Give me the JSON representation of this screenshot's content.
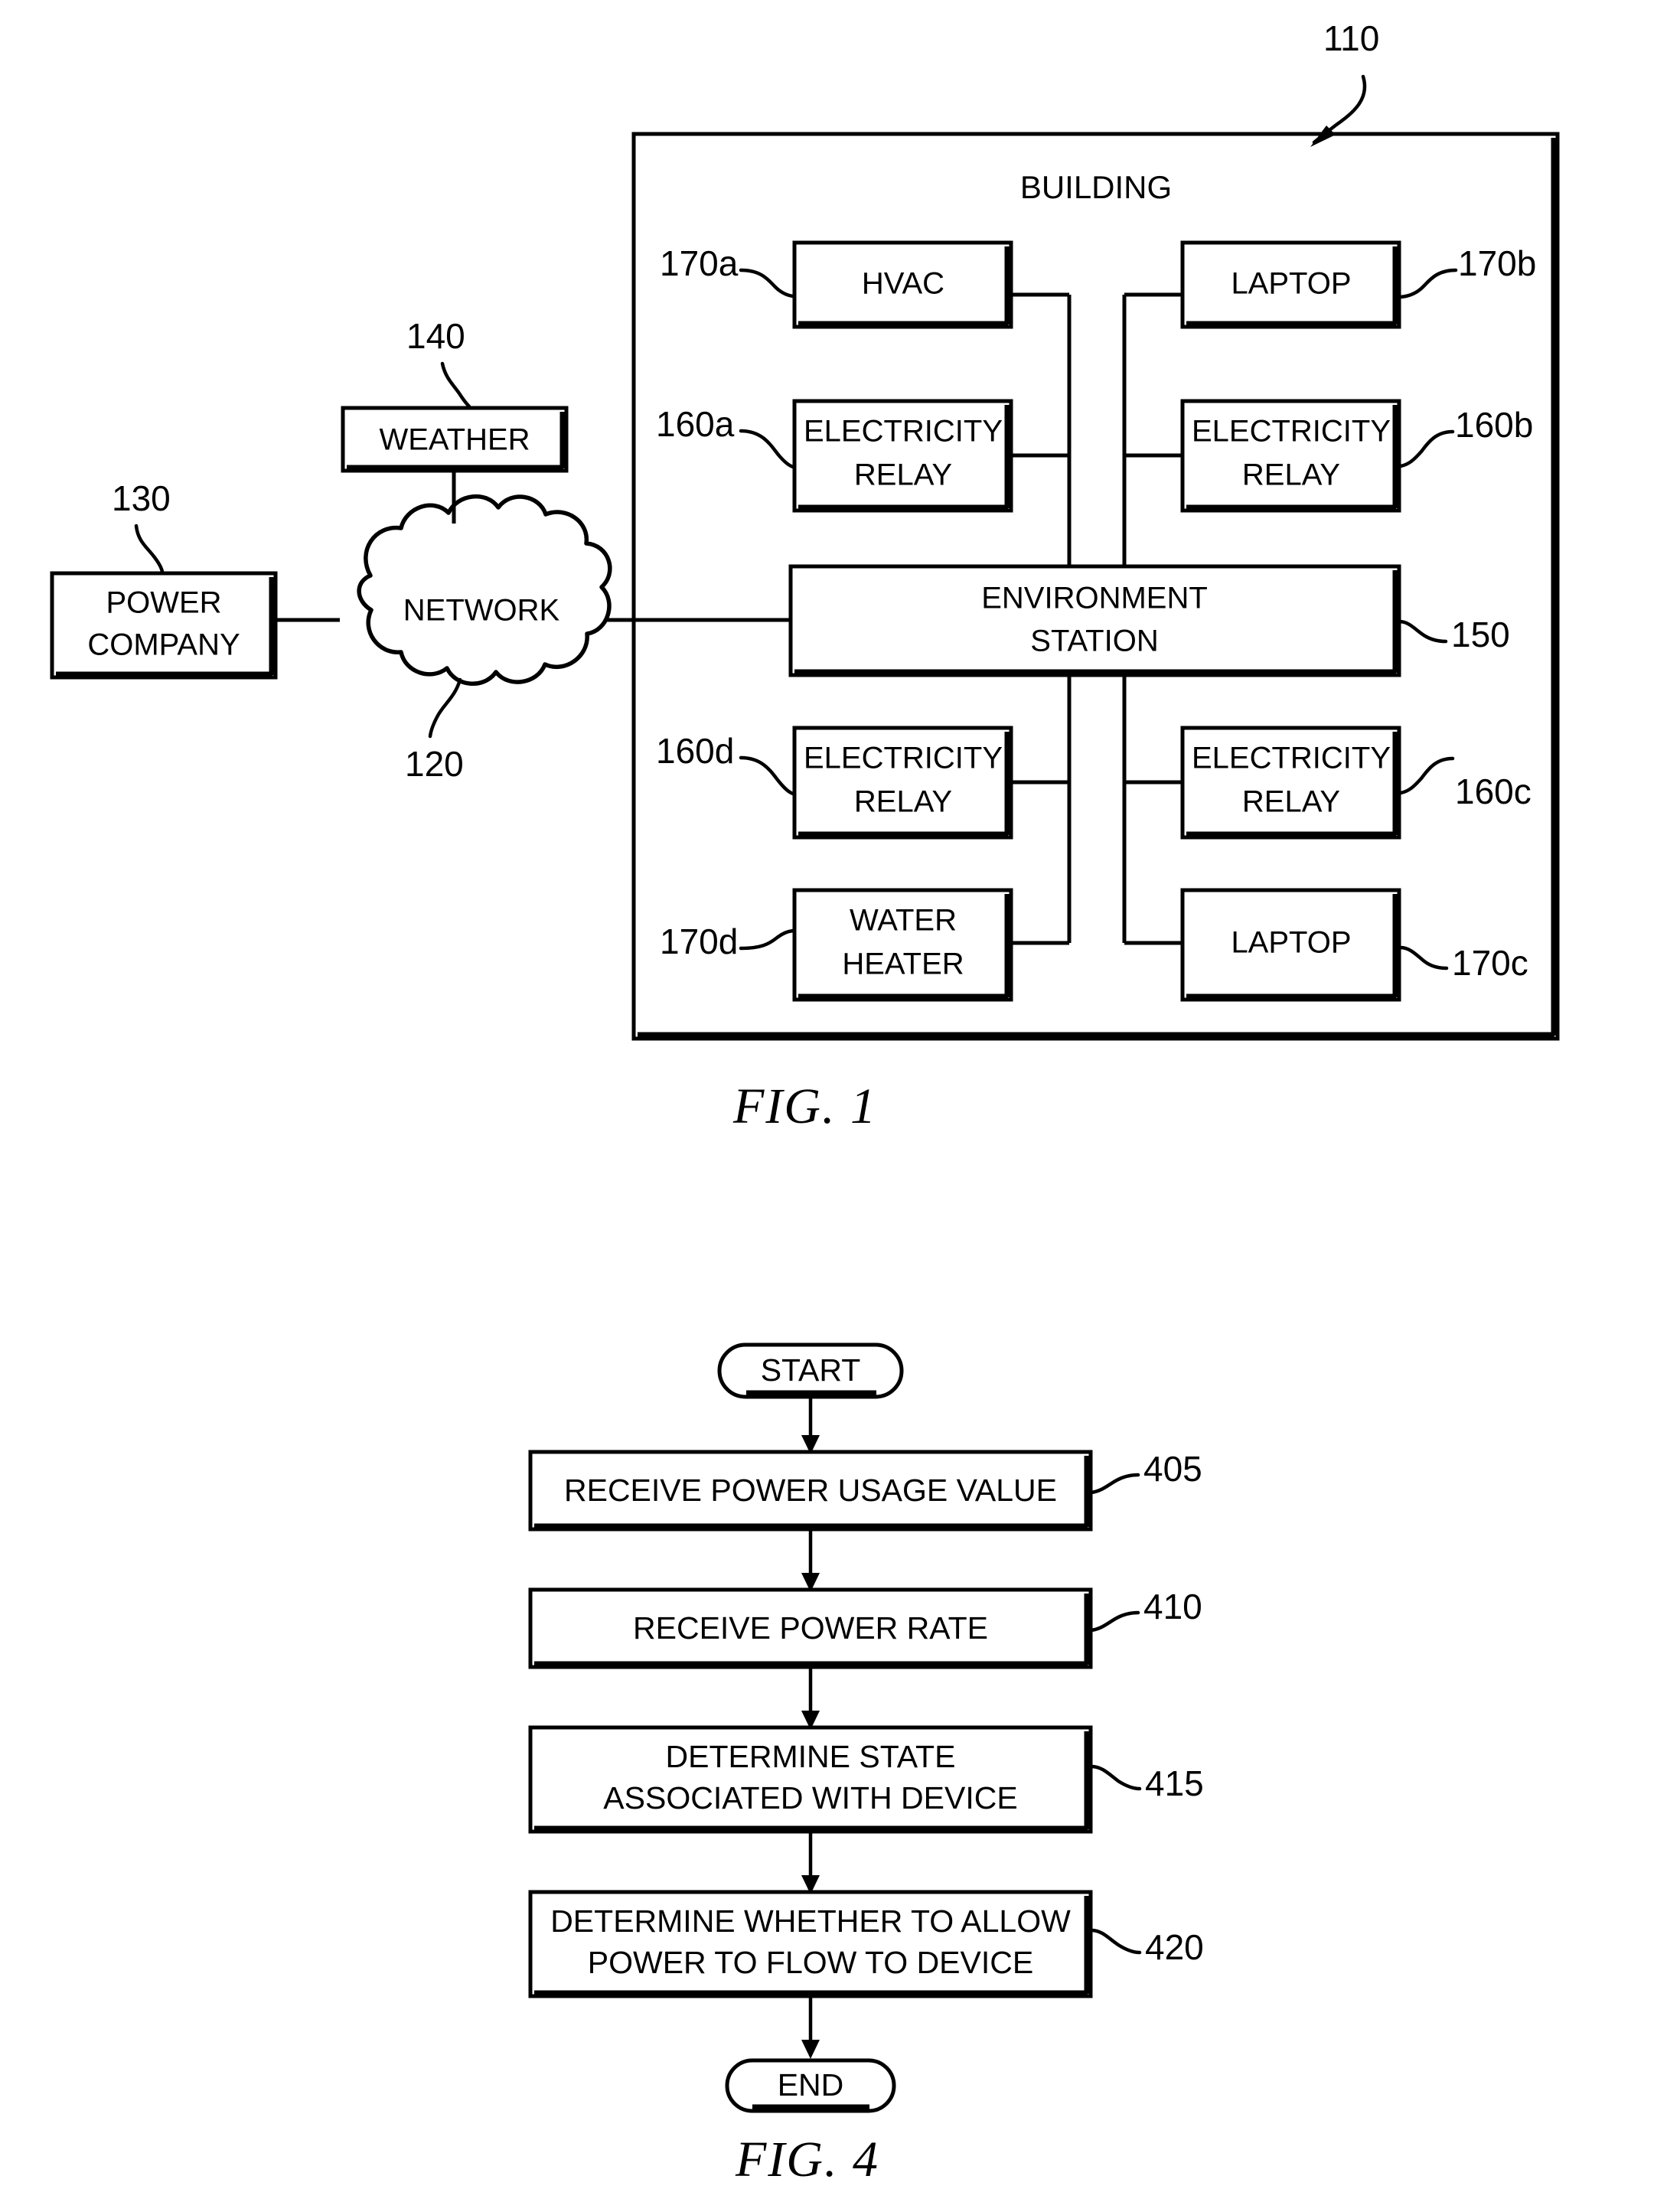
{
  "figure1": {
    "caption": "FIG. 1",
    "title_label": "BUILDING",
    "building_ref": "110",
    "nodes": {
      "power_company": {
        "label_line1": "POWER",
        "label_line2": "COMPANY",
        "ref": "130"
      },
      "network": {
        "label": "NETWORK",
        "ref": "120"
      },
      "weather": {
        "label": "WEATHER",
        "ref": "140"
      },
      "environment_station": {
        "label_line1": "ENVIRONMENT",
        "label_line2": "STATION",
        "ref": "150"
      },
      "hvac": {
        "label": "HVAC",
        "ref": "170a"
      },
      "laptop_b": {
        "label": "LAPTOP",
        "ref": "170b"
      },
      "relay_a": {
        "label_line1": "ELECTRICITY",
        "label_line2": "RELAY",
        "ref": "160a"
      },
      "relay_b": {
        "label_line1": "ELECTRICITY",
        "label_line2": "RELAY",
        "ref": "160b"
      },
      "relay_c": {
        "label_line1": "ELECTRICITY",
        "label_line2": "RELAY",
        "ref": "160c"
      },
      "relay_d": {
        "label_line1": "ELECTRICITY",
        "label_line2": "RELAY",
        "ref": "160d"
      },
      "water_heater": {
        "label_line1": "WATER",
        "label_line2": "HEATER",
        "ref": "170d"
      },
      "laptop_c": {
        "label": "LAPTOP",
        "ref": "170c"
      }
    }
  },
  "figure4": {
    "caption": "FIG. 4",
    "start_label": "START",
    "end_label": "END",
    "steps": [
      {
        "ref": "405",
        "line1": "RECEIVE POWER USAGE VALUE",
        "line2": ""
      },
      {
        "ref": "410",
        "line1": "RECEIVE POWER RATE",
        "line2": ""
      },
      {
        "ref": "415",
        "line1": "DETERMINE STATE",
        "line2": "ASSOCIATED WITH DEVICE"
      },
      {
        "ref": "420",
        "line1": "DETERMINE WHETHER TO ALLOW",
        "line2": "POWER TO FLOW TO DEVICE"
      }
    ]
  },
  "colors": {
    "ink": "#000000",
    "paper": "#ffffff"
  }
}
